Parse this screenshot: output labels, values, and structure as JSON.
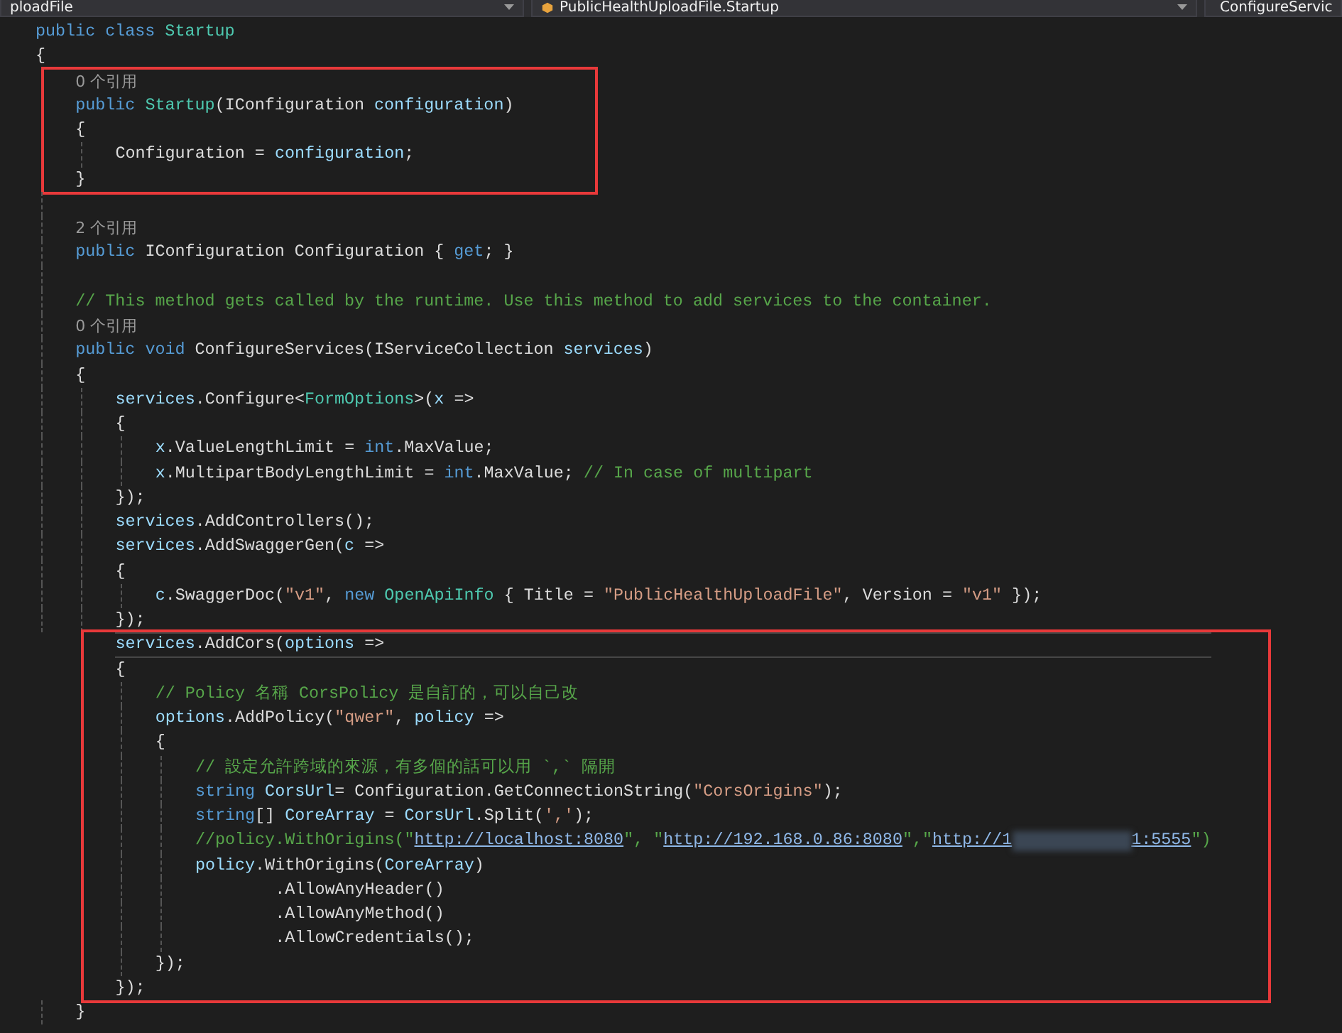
{
  "nav_bar": [
    {
      "label": "ploadFile"
    },
    {
      "label": "PublicHealthUploadFile.Startup"
    },
    {
      "label": "ConfigureServic"
    }
  ],
  "code": [
    {
      "kind": "line",
      "tokens": [
        {
          "kind": "kw",
          "text": "public class"
        },
        {
          "kind": "type",
          "text": " Startup"
        }
      ]
    },
    {
      "kind": "line",
      "tokens": [
        {
          "kind": "plain",
          "text": "{"
        }
      ],
      "children": [
        {
          "kind": "box",
          "items": [
            {
              "kind": "line",
              "tokens": [
                {
                  "kind": "lens",
                  "text": "0 个引用"
                }
              ]
            },
            {
              "kind": "line",
              "tokens": [
                {
                  "kind": "kw",
                  "text": "public"
                },
                {
                  "kind": "type",
                  "text": " Startup"
                },
                {
                  "kind": "plain",
                  "text": "(IConfiguration "
                },
                {
                  "kind": "id",
                  "text": "configuration"
                },
                {
                  "kind": "plain",
                  "text": ")"
                }
              ]
            },
            {
              "kind": "line",
              "tokens": [
                {
                  "kind": "plain",
                  "text": "{"
                }
              ],
              "children": [
                {
                  "kind": "line",
                  "tokens": [
                    {
                      "kind": "plain",
                      "text": "Configuration = "
                    },
                    {
                      "kind": "id",
                      "text": "configuration"
                    },
                    {
                      "kind": "plain",
                      "text": ";"
                    }
                  ]
                }
              ]
            },
            {
              "kind": "line",
              "tokens": [
                {
                  "kind": "plain",
                  "text": "}"
                }
              ]
            }
          ]
        },
        {
          "kind": "blank"
        },
        {
          "kind": "line",
          "tokens": [
            {
              "kind": "lens",
              "text": "2 个引用"
            }
          ]
        },
        {
          "kind": "line",
          "tokens": [
            {
              "kind": "kw",
              "text": "public"
            },
            {
              "kind": "plain",
              "text": " IConfiguration Configuration { "
            },
            {
              "kind": "kw",
              "text": "get"
            },
            {
              "kind": "plain",
              "text": "; }"
            }
          ]
        },
        {
          "kind": "blank"
        },
        {
          "kind": "line",
          "tokens": [
            {
              "kind": "cm",
              "text": "// This method gets called by the runtime. Use this method to add services to the container."
            }
          ]
        },
        {
          "kind": "line",
          "tokens": [
            {
              "kind": "lens",
              "text": "0 个引用"
            }
          ]
        },
        {
          "kind": "line",
          "tokens": [
            {
              "kind": "kw",
              "text": "public void"
            },
            {
              "kind": "plain",
              "text": " ConfigureServices(IServiceCollection "
            },
            {
              "kind": "id",
              "text": "services"
            },
            {
              "kind": "plain",
              "text": ")"
            }
          ]
        },
        {
          "kind": "line",
          "tokens": [
            {
              "kind": "plain",
              "text": "{"
            }
          ],
          "children": [
            {
              "kind": "line",
              "tokens": [
                {
                  "kind": "id",
                  "text": "services"
                },
                {
                  "kind": "plain",
                  "text": ".Configure<"
                },
                {
                  "kind": "type",
                  "text": "FormOptions"
                },
                {
                  "kind": "plain",
                  "text": ">("
                },
                {
                  "kind": "id",
                  "text": "x"
                },
                {
                  "kind": "plain",
                  "text": " =>"
                }
              ]
            },
            {
              "kind": "line",
              "tokens": [
                {
                  "kind": "plain",
                  "text": "{"
                }
              ],
              "children": [
                {
                  "kind": "line",
                  "tokens": [
                    {
                      "kind": "id",
                      "text": "x"
                    },
                    {
                      "kind": "plain",
                      "text": ".ValueLengthLimit = "
                    },
                    {
                      "kind": "kw",
                      "text": "int"
                    },
                    {
                      "kind": "plain",
                      "text": ".MaxValue;"
                    }
                  ]
                },
                {
                  "kind": "line",
                  "tokens": [
                    {
                      "kind": "id",
                      "text": "x"
                    },
                    {
                      "kind": "plain",
                      "text": ".MultipartBodyLengthLimit = "
                    },
                    {
                      "kind": "kw",
                      "text": "int"
                    },
                    {
                      "kind": "plain",
                      "text": ".MaxValue;"
                    },
                    {
                      "kind": "cm",
                      "text": " // In case of multipart"
                    }
                  ]
                }
              ]
            },
            {
              "kind": "line",
              "tokens": [
                {
                  "kind": "plain",
                  "text": "});"
                }
              ]
            },
            {
              "kind": "line",
              "tokens": [
                {
                  "kind": "id",
                  "text": "services"
                },
                {
                  "kind": "plain",
                  "text": ".AddControllers();"
                }
              ]
            },
            {
              "kind": "line",
              "tokens": [
                {
                  "kind": "id",
                  "text": "services"
                },
                {
                  "kind": "plain",
                  "text": ".AddSwaggerGen("
                },
                {
                  "kind": "id",
                  "text": "c"
                },
                {
                  "kind": "plain",
                  "text": " =>"
                }
              ]
            },
            {
              "kind": "line",
              "tokens": [
                {
                  "kind": "plain",
                  "text": "{"
                }
              ],
              "children": [
                {
                  "kind": "line",
                  "tokens": [
                    {
                      "kind": "id",
                      "text": "c"
                    },
                    {
                      "kind": "plain",
                      "text": ".SwaggerDoc("
                    },
                    {
                      "kind": "str",
                      "text": "\"v1\""
                    },
                    {
                      "kind": "plain",
                      "text": ", "
                    },
                    {
                      "kind": "kw",
                      "text": "new"
                    },
                    {
                      "kind": "type",
                      "text": " OpenApiInfo"
                    },
                    {
                      "kind": "plain",
                      "text": " { Title = "
                    },
                    {
                      "kind": "str",
                      "text": "\"PublicHealthUploadFile\""
                    },
                    {
                      "kind": "plain",
                      "text": ", Version = "
                    },
                    {
                      "kind": "str",
                      "text": "\"v1\""
                    },
                    {
                      "kind": "plain",
                      "text": " });"
                    }
                  ]
                }
              ]
            },
            {
              "kind": "line",
              "tokens": [
                {
                  "kind": "plain",
                  "text": "});"
                }
              ]
            },
            {
              "kind": "box",
              "items": [
                {
                  "kind": "line",
                  "current": true,
                  "tokens": [
                    {
                      "kind": "id",
                      "text": "services"
                    },
                    {
                      "kind": "plain",
                      "text": ".AddCors("
                    },
                    {
                      "kind": "id",
                      "text": "options"
                    },
                    {
                      "kind": "plain",
                      "text": " =>"
                    }
                  ]
                },
                {
                  "kind": "line",
                  "tokens": [
                    {
                      "kind": "plain",
                      "text": "{"
                    }
                  ],
                  "children": [
                    {
                      "kind": "line",
                      "tokens": [
                        {
                          "kind": "cm",
                          "text": "// Policy 名稱 CorsPolicy 是自訂的，可以自己改"
                        }
                      ]
                    },
                    {
                      "kind": "line",
                      "tokens": [
                        {
                          "kind": "id",
                          "text": "options"
                        },
                        {
                          "kind": "plain",
                          "text": ".AddPolicy("
                        },
                        {
                          "kind": "str",
                          "text": "\"qwer\""
                        },
                        {
                          "kind": "plain",
                          "text": ", "
                        },
                        {
                          "kind": "id",
                          "text": "policy"
                        },
                        {
                          "kind": "plain",
                          "text": " =>"
                        }
                      ]
                    },
                    {
                      "kind": "line",
                      "tokens": [
                        {
                          "kind": "plain",
                          "text": "{"
                        }
                      ],
                      "children": [
                        {
                          "kind": "line",
                          "tokens": [
                            {
                              "kind": "cm",
                              "text": "// 設定允許跨域的來源，有多個的話可以用 `,` 隔開"
                            }
                          ]
                        },
                        {
                          "kind": "line",
                          "tokens": [
                            {
                              "kind": "kw",
                              "text": "string"
                            },
                            {
                              "kind": "id",
                              "text": " CorsUrl"
                            },
                            {
                              "kind": "plain",
                              "text": "= Configuration.GetConnectionString("
                            },
                            {
                              "kind": "str",
                              "text": "\"CorsOrigins\""
                            },
                            {
                              "kind": "plain",
                              "text": ");"
                            }
                          ]
                        },
                        {
                          "kind": "line",
                          "tokens": [
                            {
                              "kind": "kw",
                              "text": "string"
                            },
                            {
                              "kind": "plain",
                              "text": "[] "
                            },
                            {
                              "kind": "id",
                              "text": "CoreArray"
                            },
                            {
                              "kind": "plain",
                              "text": " = "
                            },
                            {
                              "kind": "id",
                              "text": "CorsUrl"
                            },
                            {
                              "kind": "plain",
                              "text": ".Split("
                            },
                            {
                              "kind": "str",
                              "text": "','"
                            },
                            {
                              "kind": "plain",
                              "text": ");"
                            }
                          ]
                        },
                        {
                          "kind": "line",
                          "tokens": [
                            {
                              "kind": "cm",
                              "text": "//policy.WithOrigins(\""
                            },
                            {
                              "kind": "link",
                              "text": "http://localhost:8080"
                            },
                            {
                              "kind": "cm",
                              "text": "\", \""
                            },
                            {
                              "kind": "link",
                              "text": "http://192.168.0.86:8080"
                            },
                            {
                              "kind": "cm",
                              "text": "\",\""
                            },
                            {
                              "kind": "link",
                              "text": "http://1"
                            },
                            {
                              "kind": "blur"
                            },
                            {
                              "kind": "link",
                              "text": "1:5555"
                            },
                            {
                              "kind": "cm",
                              "text": "\")"
                            }
                          ]
                        },
                        {
                          "kind": "line",
                          "tokens": [
                            {
                              "kind": "id",
                              "text": "policy"
                            },
                            {
                              "kind": "plain",
                              "text": ".WithOrigins("
                            },
                            {
                              "kind": "id",
                              "text": "CoreArray"
                            },
                            {
                              "kind": "plain",
                              "text": ")"
                            }
                          ],
                          "children": [
                            {
                              "kind": "continuation",
                              "tokens": [
                                {
                                  "kind": "plain",
                                  "text": ".AllowAnyHeader()"
                                }
                              ]
                            },
                            {
                              "kind": "continuation",
                              "tokens": [
                                {
                                  "kind": "plain",
                                  "text": ".AllowAnyMethod()"
                                }
                              ]
                            },
                            {
                              "kind": "continuation",
                              "tokens": [
                                {
                                  "kind": "plain",
                                  "text": ".AllowCredentials();"
                                }
                              ]
                            }
                          ]
                        }
                      ]
                    },
                    {
                      "kind": "line",
                      "tokens": [
                        {
                          "kind": "plain",
                          "text": "});"
                        }
                      ]
                    }
                  ]
                },
                {
                  "kind": "line",
                  "tokens": [
                    {
                      "kind": "plain",
                      "text": "});"
                    }
                  ]
                }
              ]
            }
          ]
        },
        {
          "kind": "line",
          "tokens": [
            {
              "kind": "plain",
              "text": "}"
            }
          ]
        }
      ]
    }
  ]
}
